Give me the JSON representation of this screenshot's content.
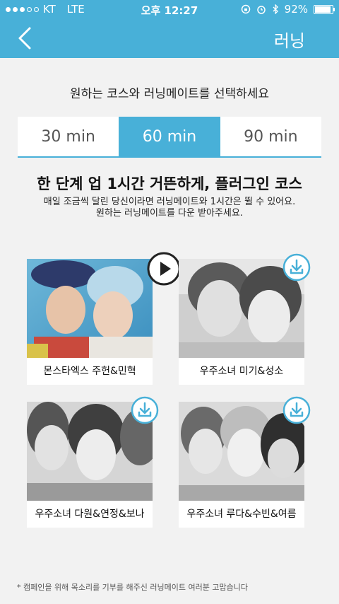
{
  "status_bar": {
    "carrier": "KT",
    "network": "LTE",
    "time": "오후 12:27",
    "battery": "92%",
    "battery_level": 0.92
  },
  "nav": {
    "back_icon": "chevron-left-icon",
    "title": "러닝"
  },
  "subtitle": "원하는 코스와 러닝메이트를 선택하세요",
  "segments": [
    {
      "label": "30 min",
      "active": false
    },
    {
      "label": "60 min",
      "active": true
    },
    {
      "label": "90 min",
      "active": false
    }
  ],
  "course": {
    "headline": "한 단계 업 1시간 거뜬하게, 플러그인 코스",
    "desc_line1": "매일 조금씩 달린 당신이라면 러닝메이트와 1시간은 뛸 수 있어요.",
    "desc_line2": "원하는 러닝메이트를 다운 받아주세요."
  },
  "mates": [
    {
      "name": "몬스타엑스 주헌&민혁",
      "action": "play-icon"
    },
    {
      "name": "우주소녀 미기&성소",
      "action": "download-icon"
    },
    {
      "name": "우주소녀 다원&연정&보나",
      "action": "download-icon"
    },
    {
      "name": "우주소녀 루다&수빈&여름",
      "action": "download-icon"
    }
  ],
  "footnote": "* 캠페인을 위해 목소리를 기부를 해주신 러닝메이트 여러분 고맙습니다",
  "colors": {
    "accent": "#48b0d8",
    "background": "#f2f2f2"
  }
}
